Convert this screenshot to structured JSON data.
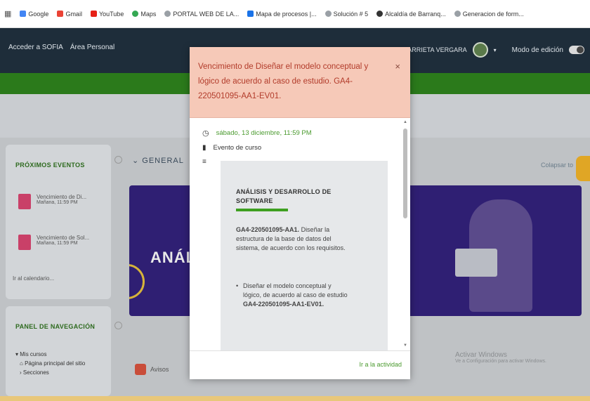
{
  "bookmarks": [
    {
      "label": "Google",
      "color": "#4285f4"
    },
    {
      "label": "Gmail",
      "color": "#ea4335"
    },
    {
      "label": "YouTube",
      "color": "#e62117"
    },
    {
      "label": "Maps",
      "color": "#34a853"
    },
    {
      "label": "PORTAL WEB DE LA...",
      "color": "#9aa0a6"
    },
    {
      "label": "Mapa de procesos |...",
      "color": "#1a73e8"
    },
    {
      "label": "Solución # 5",
      "color": "#9aa0a6"
    },
    {
      "label": "Alcaldía de Barranq...",
      "color": "#333333"
    },
    {
      "label": "Generacion de form...",
      "color": "#9aa0a6"
    }
  ],
  "navbar": {
    "links": [
      "Acceder a SOFIA",
      "Área Personal"
    ],
    "user_name": "ADO ARRIETA VERGARA",
    "edit_mode_label": "Modo de edición"
  },
  "sidebar": {
    "events_heading": "PRÓXIMOS EVENTOS",
    "events": [
      {
        "title": "Vencimiento de Di...",
        "time": "Mañana, 11:59 PM"
      },
      {
        "title": "Vencimiento de Sol...",
        "time": "Mañana, 11:59 PM"
      }
    ],
    "calendar_link": "Ir al calendario...",
    "nav_heading": "PANEL DE NAVEGACIÓN",
    "nav_items": [
      "Mis cursos",
      "Página principal del sitio",
      "Secciones"
    ]
  },
  "course": {
    "section_title": "GENERAL",
    "collapse_all": "Colapsar to",
    "banner_title": "ANÁLI",
    "announcements": "Avisos",
    "watermark_title": "Activar Windows",
    "watermark_sub": "Ve a Configuración para activar Windows."
  },
  "modal": {
    "title": "Vencimiento de Diseñar el modelo conceptual y lógico de acuerdo al caso de estudio. GA4-220501095-AA1-EV01.",
    "close_symbol": "×",
    "date": "sábado, 13 diciembre, 11:59 PM",
    "event_type": "Evento de curso",
    "card_title": "ANÁLISIS Y DESARROLLO DE SOFTWARE",
    "card_code": "GA4-220501095-AA1.",
    "card_text": " Diseñar la estructura de la base de datos del sistema, de acuerdo con los requisitos.",
    "card_bullet_text": "Diseñar el modelo conceptual y lógico, de acuerdo al caso de estudio ",
    "card_bullet_code": "GA4-220501095-AA1-EV01.",
    "go_activity": "Ir a la actividad"
  },
  "colors": {
    "header_bg": "#f6c9b8",
    "accent_green": "#4a9a2e",
    "navbar": "#1e2d3a"
  }
}
